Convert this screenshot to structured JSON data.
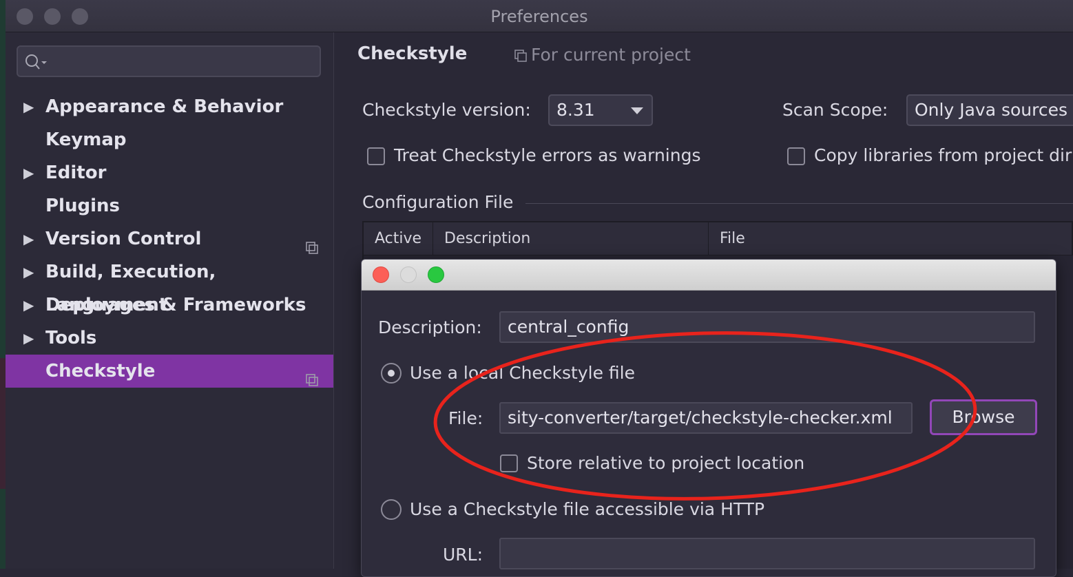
{
  "window": {
    "title": "Preferences"
  },
  "sidebar": {
    "search_placeholder": "",
    "items": [
      {
        "label": "Appearance & Behavior",
        "expandable": true,
        "project_icon": false
      },
      {
        "label": "Keymap",
        "expandable": false,
        "project_icon": false
      },
      {
        "label": "Editor",
        "expandable": true,
        "project_icon": false
      },
      {
        "label": "Plugins",
        "expandable": false,
        "project_icon": false
      },
      {
        "label": "Version Control",
        "expandable": true,
        "project_icon": true
      },
      {
        "label": "Build, Execution, Deployment",
        "expandable": true,
        "project_icon": false
      },
      {
        "label": "Languages & Frameworks",
        "expandable": true,
        "project_icon": false
      },
      {
        "label": "Tools",
        "expandable": true,
        "project_icon": false
      },
      {
        "label": "Checkstyle",
        "expandable": false,
        "project_icon": true,
        "selected": true
      }
    ]
  },
  "main": {
    "title": "Checkstyle",
    "scope_note": "For current project",
    "version_label": "Checkstyle version:",
    "version_value": "8.31",
    "scan_scope_label": "Scan Scope:",
    "scan_scope_value": "Only Java sources",
    "treat_errors_label": "Treat Checkstyle errors as warnings",
    "copy_libraries_label": "Copy libraries from project dir",
    "config_section_label": "Configuration File",
    "table_headers": [
      "Active",
      "Description",
      "File"
    ]
  },
  "dialog": {
    "description_label": "Description:",
    "description_value": "central_config",
    "local_file_option": "Use a local Checkstyle file",
    "file_label": "File:",
    "file_value": "sity-converter/target/checkstyle-checker.xml",
    "browse_label": "Browse",
    "store_relative_label": "Store relative to project location",
    "http_option": "Use a Checkstyle file accessible via HTTP",
    "url_label": "URL:",
    "url_value": ""
  },
  "colors": {
    "selection": "#7f34a3",
    "annotation": "#e8231c",
    "browse_border": "#9247b8"
  }
}
